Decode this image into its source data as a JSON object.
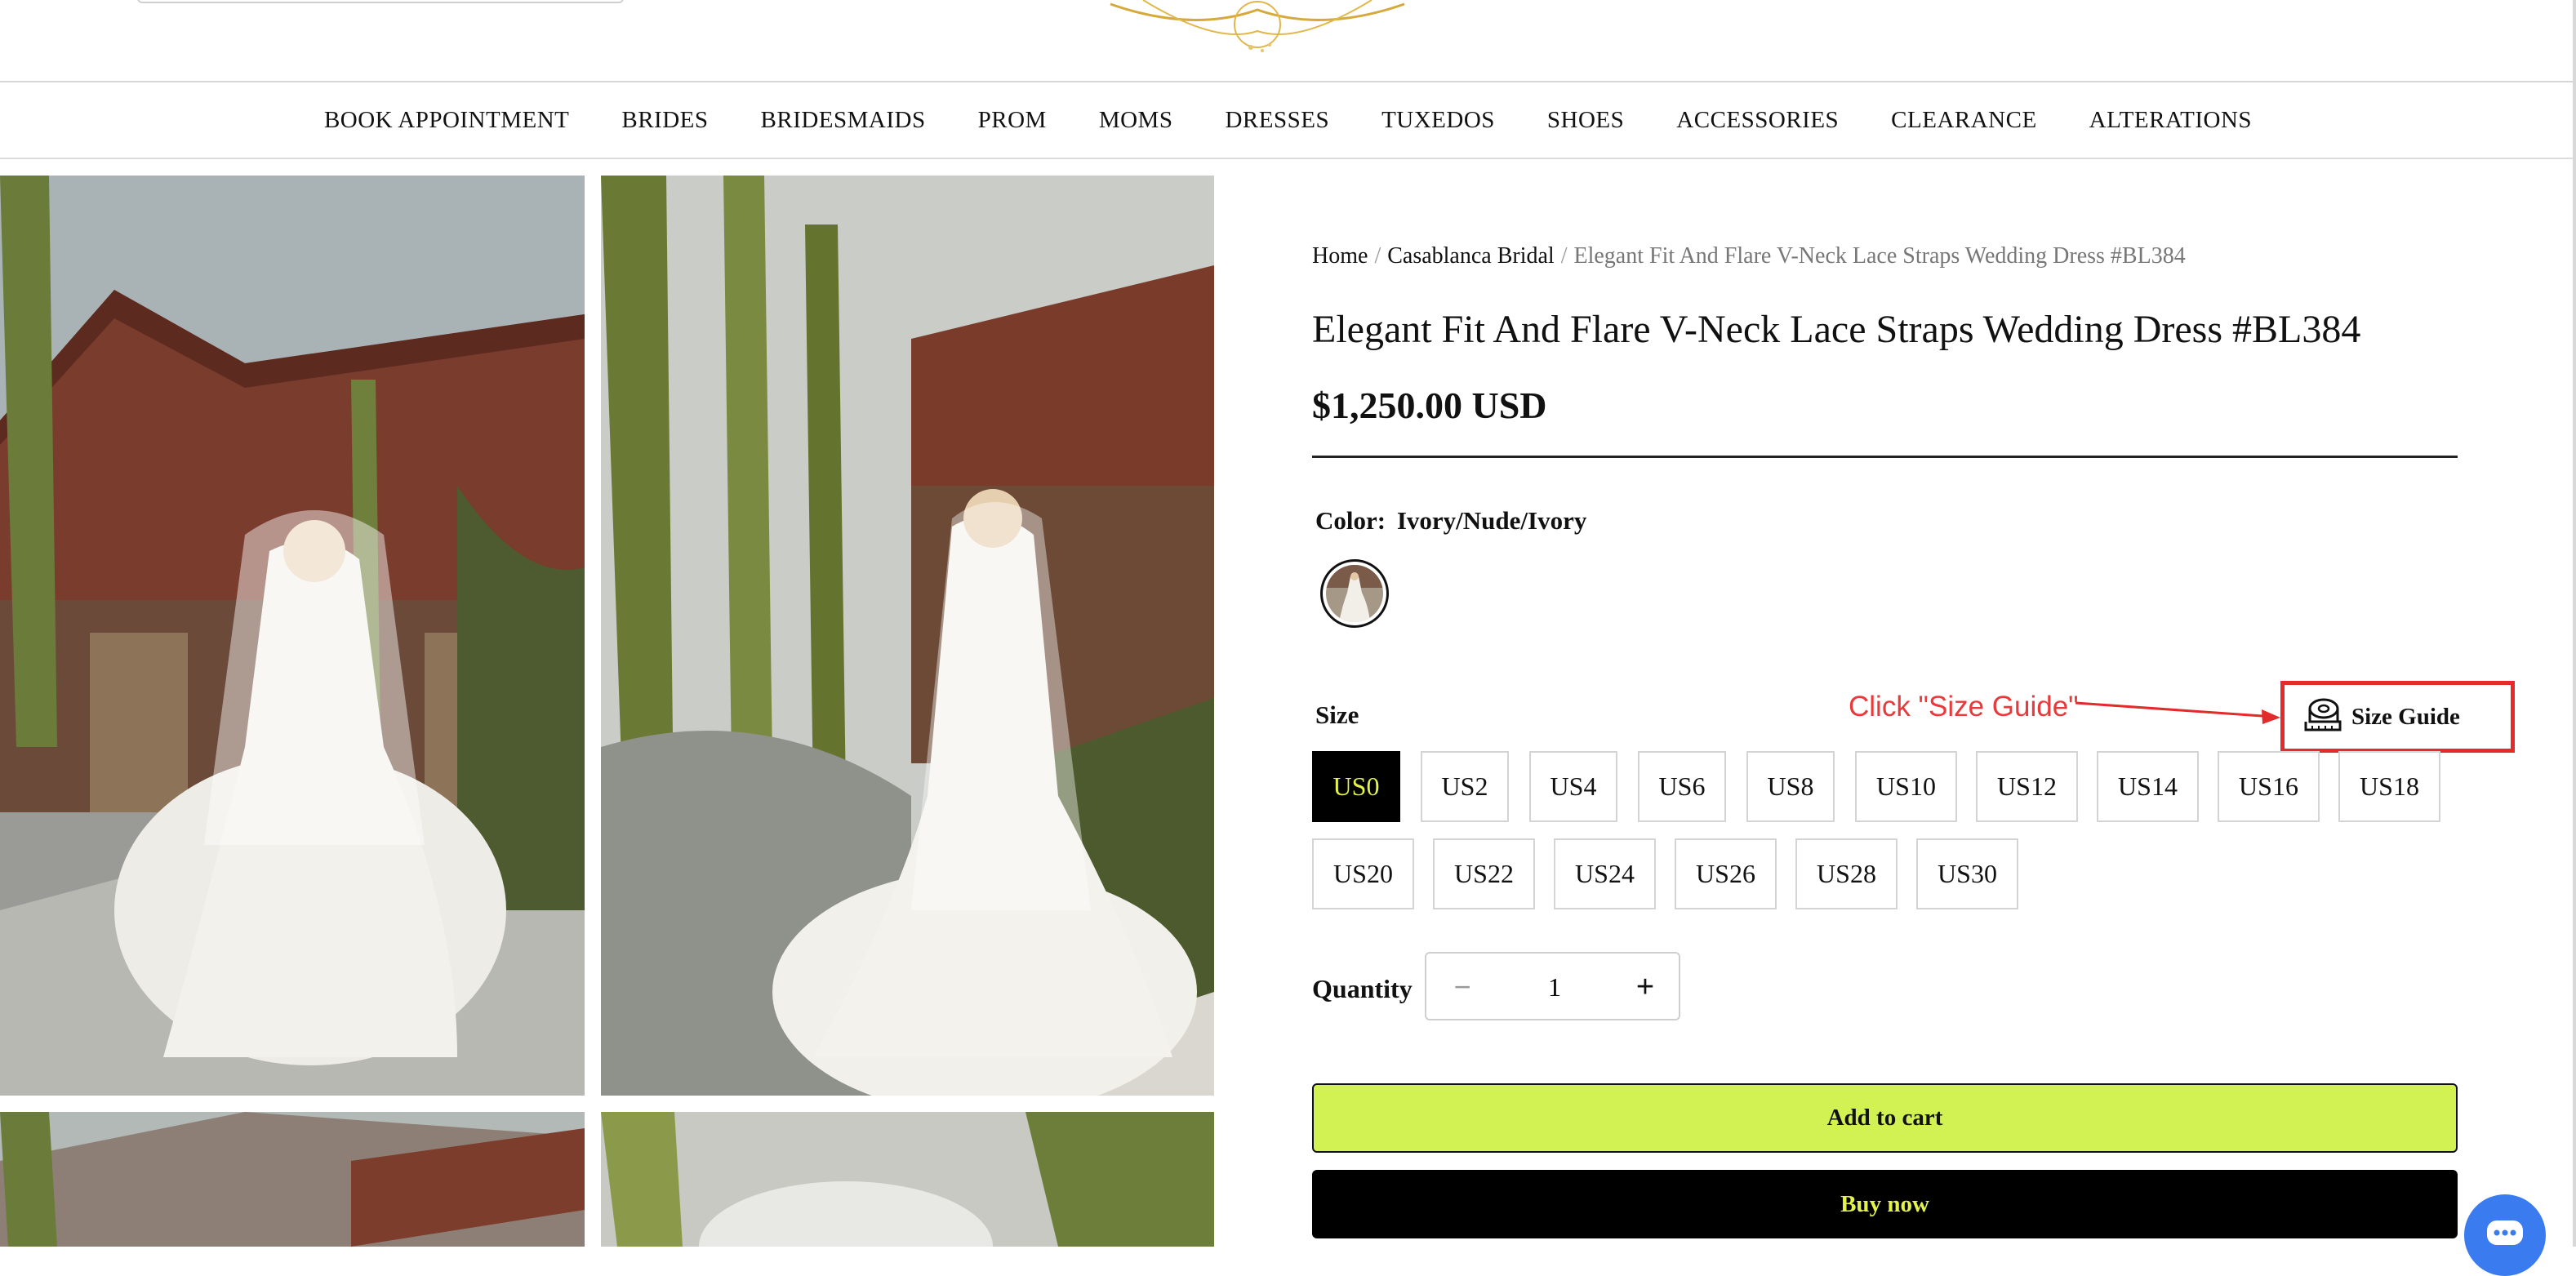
{
  "nav": {
    "items": [
      "BOOK APPOINTMENT",
      "BRIDES",
      "BRIDESMAIDS",
      "PROM",
      "MOMS",
      "DRESSES",
      "TUXEDOS",
      "SHOES",
      "ACCESSORIES",
      "CLEARANCE",
      "ALTERATIONS"
    ]
  },
  "breadcrumb": {
    "home": "Home",
    "separator": "/",
    "category": "Casablanca Bridal",
    "current": "Elegant Fit And Flare V-Neck Lace Straps Wedding Dress #BL384"
  },
  "product": {
    "title": "Elegant Fit And Flare V-Neck Lace Straps Wedding Dress #BL384",
    "price": "$1,250.00 USD",
    "color_label": "Color:",
    "color_value": "Ivory/Nude/Ivory",
    "size_label": "Size",
    "sizes_row1": [
      "US0",
      "US2",
      "US4",
      "US6",
      "US8",
      "US10",
      "US12",
      "US14",
      "US16",
      "US18"
    ],
    "sizes_row2": [
      "US20",
      "US22",
      "US24",
      "US26",
      "US28",
      "US30"
    ],
    "selected_size": "US0",
    "size_guide_label": "Size Guide",
    "quantity_label": "Quantity",
    "quantity_value": "1",
    "qty_minus": "−",
    "qty_plus": "+",
    "add_to_cart": "Add to cart",
    "buy_now": "Buy now"
  },
  "annotation": {
    "text": "Click \"Size Guide\""
  },
  "colors": {
    "accent_lime": "#d2f254",
    "selected_text": "#e4f24a",
    "annotation_red": "#e32b2b",
    "chat_blue": "#3a7bf0"
  }
}
